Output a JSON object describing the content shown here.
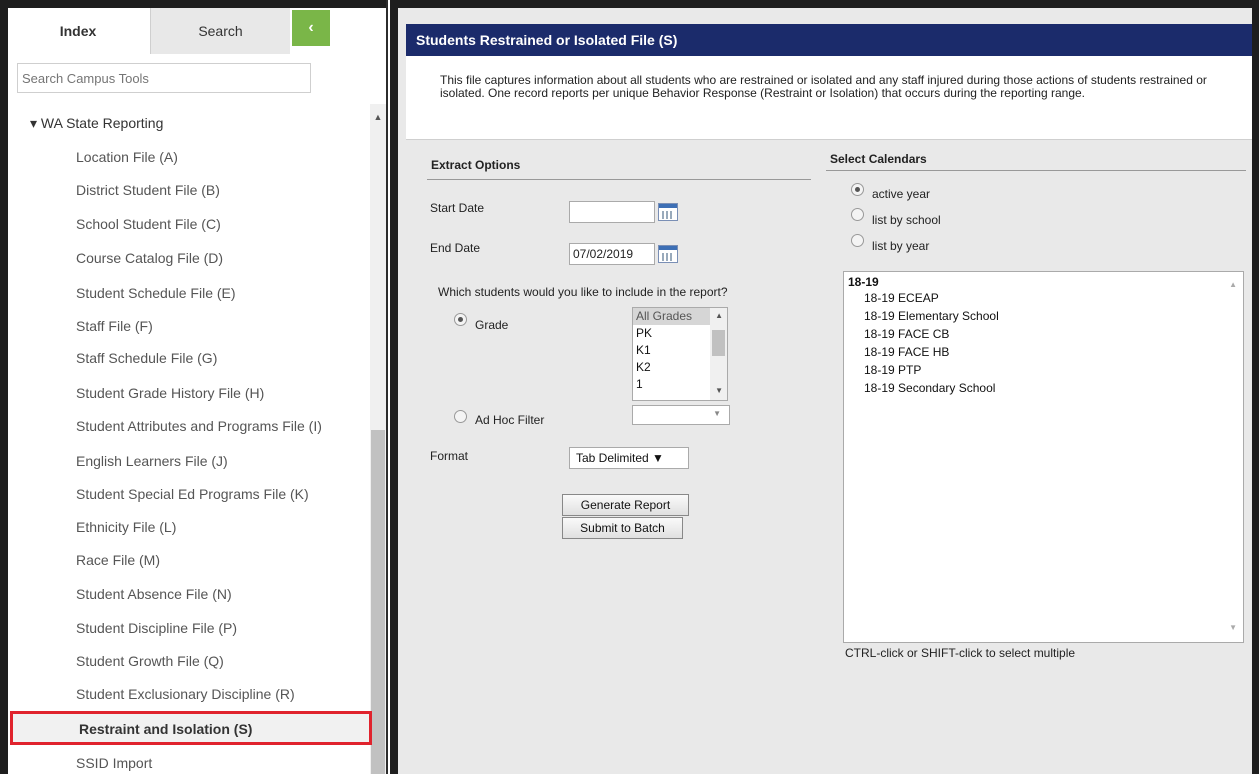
{
  "sidebar": {
    "tabs": [
      {
        "label": "Index"
      },
      {
        "label": "Search"
      }
    ],
    "collapse_label": "‹",
    "search_placeholder": "Search Campus Tools",
    "tree_parent": "▾ WA State Reporting",
    "tree_items": [
      "Location File (A)",
      "District Student File (B)",
      "School Student File (C)",
      "Course Catalog File (D)",
      "Student Schedule File (E)",
      "Staff File (F)",
      "Staff Schedule File (G)",
      "Student Grade History File (H)",
      "Student Attributes and Programs File (I)",
      "English Learners File (J)",
      "Student Special Ed Programs File (K)",
      "Ethnicity File (L)",
      "Race File (M)",
      "Student Absence File (N)",
      "Student Discipline File (P)",
      "Student Growth File (Q)",
      "Student Exclusionary Discipline (R)"
    ],
    "selected_item": "Restraint and Isolation (S)",
    "next_item": "SSID Import",
    "selected_highlight_color": "#e0232d"
  },
  "main": {
    "header": "Students Restrained or Isolated File (S)",
    "description": "This file captures information about all students who are restrained or isolated and any staff injured during those actions of students restrained or isolated. One record reports per unique Behavior Response (Restraint or Isolation) that occurs during the reporting range.",
    "header_color": "#1b2b6b",
    "extract": {
      "title": "Extract Options",
      "start_date_label": "Start Date",
      "start_date_value": "",
      "end_date_label": "End Date",
      "end_date_value": "07/02/2019",
      "students_question": "Which students would you like to include in the report?",
      "grade_label": "Grade",
      "grade_options": [
        "All Grades",
        "PK",
        "K1",
        "K2",
        "1"
      ],
      "adhoc_label": "Ad Hoc Filter",
      "format_label": "Format",
      "format_value": "Tab Delimited ▼",
      "generate_button": "Generate Report",
      "batch_button": "Submit to Batch"
    },
    "calendars": {
      "title": "Select Calendars",
      "radio_options": [
        "active year",
        "list by school",
        "list by year"
      ],
      "selected_radio": "active year",
      "group": "18-19",
      "options": [
        "18-19 ECEAP",
        "18-19 Elementary School",
        "18-19 FACE CB",
        "18-19 FACE HB",
        "18-19 PTP",
        "18-19 Secondary School"
      ],
      "hint": "CTRL-click or SHIFT-click to select multiple"
    }
  }
}
